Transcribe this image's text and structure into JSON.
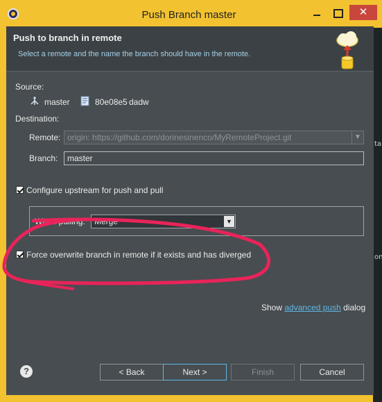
{
  "window": {
    "title": "Push Branch master"
  },
  "side_peek": {
    "a": "ta",
    "b": "on"
  },
  "banner": {
    "title": "Push to branch in remote",
    "subtitle": "Select a remote and the name the branch should have in the remote."
  },
  "source": {
    "label": "Source:",
    "branch": "master",
    "commit": "80e08e5",
    "message": "dadw"
  },
  "destination": {
    "label": "Destination:",
    "remote_label": "Remote:",
    "remote_value": "origin: https://github.com/dorinesinenco/MyRemoteProject.git",
    "branch_label": "Branch:",
    "branch_value": "master"
  },
  "options": {
    "upstream_label": "Configure upstream for push and pull",
    "upstream_checked": true,
    "when_pulling_label": "When pulling:",
    "when_pulling_value": "Merge",
    "force_label": "Force overwrite branch in remote if it exists and has diverged",
    "force_checked": true
  },
  "advanced": {
    "prefix": "Show",
    "link": "advanced push",
    "suffix": "dialog"
  },
  "buttons": {
    "help": "?",
    "back": "< Back",
    "next": "Next >",
    "finish": "Finish",
    "cancel": "Cancel"
  },
  "colors": {
    "title_bar": "#f2c230",
    "dialog_bg": "#474d50",
    "link": "#62b6e6",
    "annotation": "#e8245a"
  }
}
